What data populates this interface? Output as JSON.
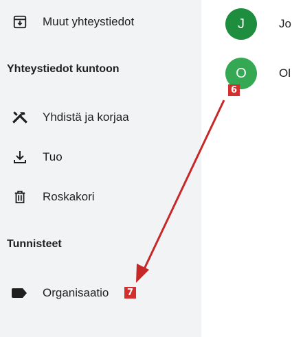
{
  "sidebar": {
    "other_contacts": {
      "label": "Muut yhteystiedot",
      "icon": "archive-icon"
    },
    "fix_section_title": "Yhteystiedot kuntoon",
    "merge_fix": {
      "label": "Yhdistä ja korjaa",
      "icon": "tools-icon"
    },
    "import": {
      "label": "Tuo",
      "icon": "download-icon"
    },
    "trash": {
      "label": "Roskakori",
      "icon": "trash-icon"
    },
    "labels_section_title": "Tunnisteet",
    "label_org": {
      "label": "Organisaatio",
      "icon": "label-icon"
    }
  },
  "contacts": [
    {
      "initial": "J",
      "name": "Jo",
      "color": "#1e8e3e"
    },
    {
      "initial": "O",
      "name": "Ol",
      "color": "#34a853"
    }
  ],
  "annotations": {
    "badge_6": "6",
    "badge_7": "7",
    "badge_color": "#d32f2f",
    "arrow_color": "#c62828"
  }
}
